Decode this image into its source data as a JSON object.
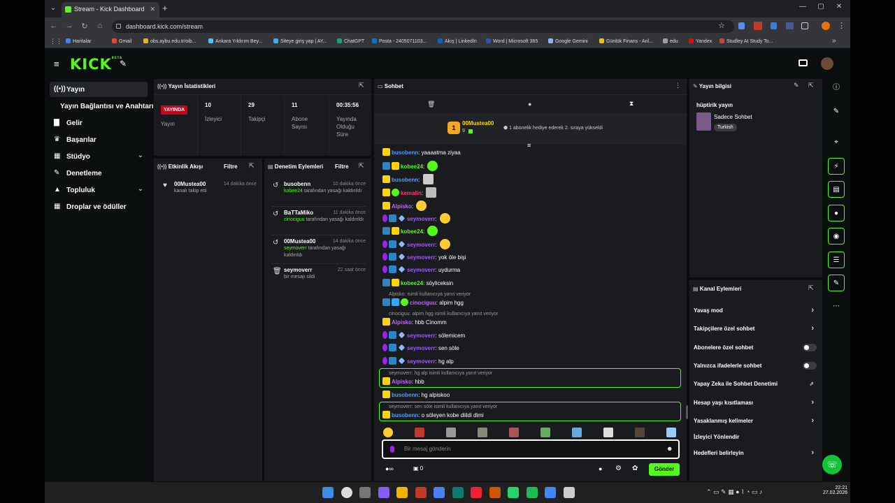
{
  "browser": {
    "tab_title": "Stream - Kick Dashboard",
    "url": "dashboard.kick.com/stream",
    "bookmarks": [
      "Haritalar",
      "Gmail",
      "obs.aybu.edu.tr/oib...",
      "Ankara Yıldırım Bey...",
      "Siteye giriş yap | AY...",
      "ChatGPT",
      "Posta - 2405071103...",
      "Akış | LinkedIn",
      "Word | Microsoft 365",
      "Google Gemini",
      "Günlük Finans - Anl...",
      "edu",
      "Yandex",
      "Studley AI Study To..."
    ],
    "bookmark_colors": [
      "#4285f4",
      "#ea4335",
      "#f4b400",
      "#4fc3f7",
      "#29b6f6",
      "#10a37f",
      "#0078d4",
      "#0a66c2",
      "#185abd",
      "#8ab4f8",
      "#fbbc04",
      "#9e9e9e",
      "#ff0000",
      "#e53935"
    ]
  },
  "brand": {
    "logo": "KICK",
    "beta": "BETA",
    "accent": "#53fc18"
  },
  "sidebar": {
    "items": [
      {
        "label": "Yayın",
        "icon": "broadcast-icon"
      },
      {
        "label": "Yayın Bağlantısı ve Anahtarı",
        "icon": ""
      },
      {
        "label": "Gelir",
        "icon": "revenue-icon"
      },
      {
        "label": "Başarılar",
        "icon": "trophy-icon"
      },
      {
        "label": "Stüdyo",
        "icon": "studio-icon"
      },
      {
        "label": "Denetleme",
        "icon": "hammer-icon"
      },
      {
        "label": "Topluluk",
        "icon": "community-icon"
      },
      {
        "label": "Droplar ve ödüller",
        "icon": "gift-icon"
      }
    ]
  },
  "stats": {
    "title": "Yayın İstatistikleri",
    "live_badge": "YAYINDA",
    "live_label": "Yayın",
    "items": [
      {
        "value": "10",
        "label": "İzleyici"
      },
      {
        "value": "29",
        "label": "Takipçi"
      },
      {
        "value": "11",
        "label": "Abone Sayısı"
      },
      {
        "value": "00:35:56",
        "label": "Yayında Olduğu Süre"
      }
    ]
  },
  "activity": {
    "title": "Etkinlik Akışı",
    "filter": "Filtre",
    "items": [
      {
        "name": "00Mustea00",
        "time": "14 dakika önce",
        "desc": "kanalı takip etti"
      }
    ]
  },
  "moderation": {
    "title": "Denetim Eylemleri",
    "filter": "Filtre",
    "items": [
      {
        "name": "busobenn",
        "time": "10 dakika önce",
        "target": "kobee24",
        "desc": "tarafından yasağı kaldırıldı"
      },
      {
        "name": "BaTTaMiko",
        "time": "11 dakika önce",
        "target": "cinociguu",
        "desc": "tarafından yasağı kaldırıldı"
      },
      {
        "name": "00Mustea00",
        "time": "14 dakika önce",
        "target": "seymoverr",
        "desc": "tarafından yasağı kaldırıldı"
      },
      {
        "name": "seymoverr",
        "time": "22 saat önce",
        "target": "",
        "desc": "bir mesajı sildi"
      }
    ]
  },
  "chat": {
    "title": "Sohbet",
    "pinned": {
      "user": "00Mustea00",
      "count": "9",
      "rank": "1",
      "text": "1 abonelik hediye ederek 2. sıraya yükseldi"
    },
    "messages": [
      {
        "user": "busobenn",
        "color": "#4b9fff",
        "text": "yaaaatma ziyaa"
      },
      {
        "user": "kobee24",
        "color": "#53fc18",
        "text": ""
      },
      {
        "user": "busobenn",
        "color": "#4b9fff",
        "text": ""
      },
      {
        "user": "kemalin",
        "color": "#ff3b6b",
        "text": ""
      },
      {
        "user": "Alpisko",
        "color": "#c065ff",
        "text": ""
      },
      {
        "user": "seymoverr",
        "color": "#a259ff",
        "text": ""
      },
      {
        "user": "kobee24",
        "color": "#53fc18",
        "text": ""
      },
      {
        "user": "seymoverr",
        "color": "#a259ff",
        "text": ""
      },
      {
        "user": "seymoverr",
        "color": "#a259ff",
        "text": "yok öle bişi"
      },
      {
        "user": "seymoverr",
        "color": "#a259ff",
        "text": "uydurma"
      },
      {
        "user": "kobee24",
        "color": "#53fc18",
        "text": "söyliceksin"
      },
      {
        "user": "cinociguu",
        "color": "#c065ff",
        "text": "alpim hgg",
        "reply": "Alpisko:  isimli kullanıcıya yanıt veriyor"
      },
      {
        "user": "Alpisko",
        "color": "#c065ff",
        "text": "hbb Cinomm",
        "reply": "cinociguu: alpim hgg isimli kullanıcıya yanıt veriyor"
      },
      {
        "user": "seymoverr",
        "color": "#a259ff",
        "text": "sölemicem"
      },
      {
        "user": "seymoverr",
        "color": "#a259ff",
        "text": "sen söle"
      },
      {
        "user": "seymoverr",
        "color": "#a259ff",
        "text": "hg alp"
      },
      {
        "user": "Alpisko",
        "color": "#c065ff",
        "text": "hbb",
        "reply": "seymoverr: hg alp isimli kullanıcıya yanıt veriyor"
      },
      {
        "user": "busobenn",
        "color": "#4b9fff",
        "text": "hg alpiskoo"
      },
      {
        "user": "busobenn",
        "color": "#4b9fff",
        "text": "o söleyen kobe diildi dimi",
        "reply": "seymoverr: sen söle isimli kullanıcıya yanıt veriyor"
      }
    ],
    "placeholder": "Bir mesaj gönderin",
    "points": "0",
    "send": "Gönder"
  },
  "stream_info": {
    "title": "Yayın bilgisi",
    "stream_title": "hüptirik yayın",
    "category": "Sadece Sohbet",
    "tag": "Turkish"
  },
  "channel_actions": {
    "title": "Kanal Eylemleri",
    "items": [
      {
        "label": "Yavaş mod",
        "control": "chevron"
      },
      {
        "label": "Takipçilere özel sohbet",
        "control": "chevron"
      },
      {
        "label": "Abonelere özel sohbet",
        "control": "toggle"
      },
      {
        "label": "Yalnızca ifadelerle sohbet",
        "control": "toggle"
      },
      {
        "label": "Yapay Zeka ile Sohbet Denetimi",
        "control": "external"
      },
      {
        "label": "Hesap yaşı kısıtlaması",
        "control": "chevron"
      },
      {
        "label": "Yasaklanmış kelimeler",
        "control": "chevron"
      },
      {
        "label": "İzleyici Yönlendir",
        "control": "none"
      },
      {
        "label": "Hedefleri belirleyin",
        "control": "chevron"
      }
    ]
  },
  "taskbar": {
    "time": "22:21",
    "date": "27.02.2026"
  }
}
